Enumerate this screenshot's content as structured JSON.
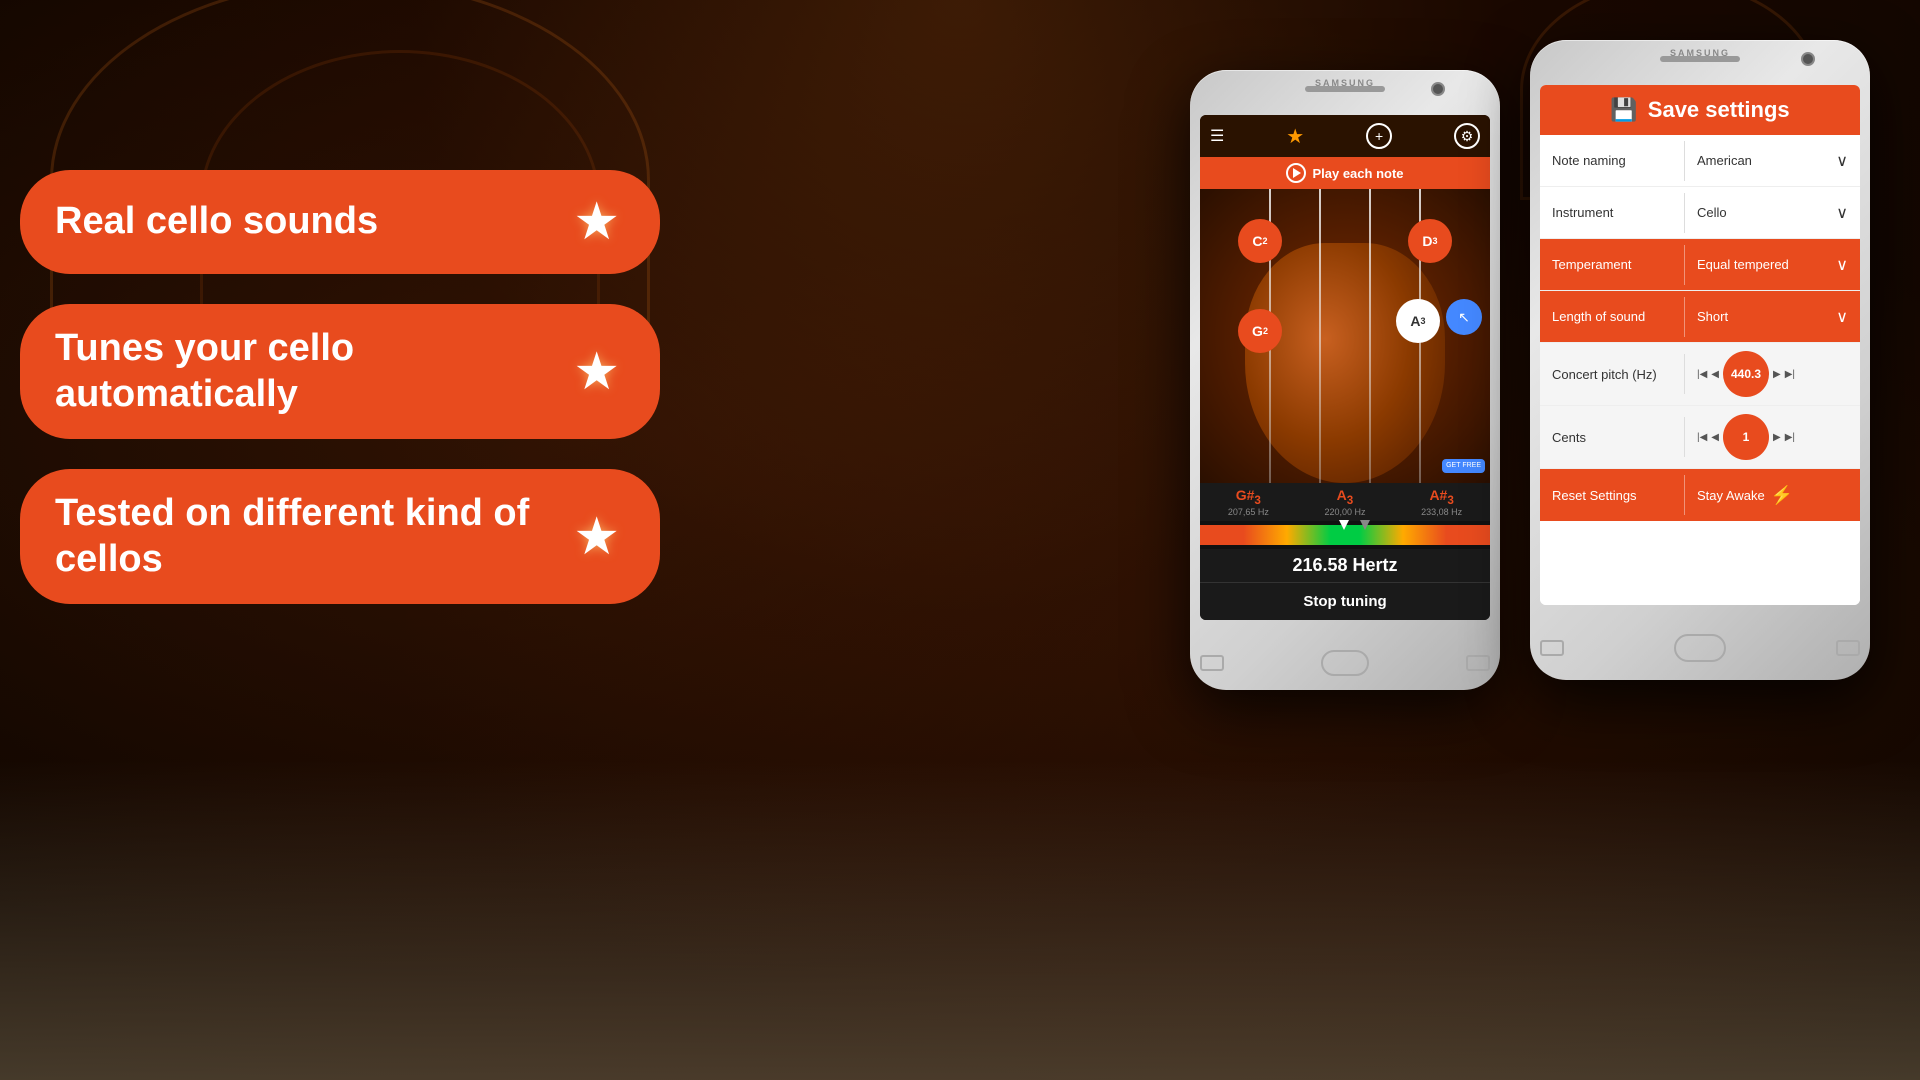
{
  "background": {
    "color": "#1a0800"
  },
  "features": {
    "items": [
      {
        "text": "Real cello sounds",
        "star": "★"
      },
      {
        "text": "Tunes your cello automatically",
        "star": "★"
      },
      {
        "text": "Tested on different kind of cellos",
        "star": "★"
      }
    ]
  },
  "phone1": {
    "brand": "SAMSUNG",
    "header": {
      "menu_icon": "☰",
      "star_icon": "★",
      "plus_icon": "+",
      "gear_icon": "⚙"
    },
    "play_button": "Play each note",
    "notes": [
      {
        "id": "c2",
        "name": "C",
        "sub": "2"
      },
      {
        "id": "d3",
        "name": "D",
        "sub": "3"
      },
      {
        "id": "g2",
        "name": "G",
        "sub": "2"
      },
      {
        "id": "a3",
        "name": "A",
        "sub": "3"
      }
    ],
    "frequencies": [
      {
        "note": "G#₃",
        "hz": "207,65 Hz"
      },
      {
        "note": "A₃",
        "hz": "220,00 Hz"
      },
      {
        "note": "A#₃",
        "hz": "233,08 Hz"
      }
    ],
    "hertz_display": "216.58 Hertz",
    "stop_button": "Stop tuning",
    "get_free": "GET FREE"
  },
  "phone2": {
    "brand": "SAMSUNG",
    "header": {
      "icon": "💾",
      "title": "Save settings"
    },
    "settings": [
      {
        "label": "Note naming",
        "value": "American",
        "has_chevron": true,
        "orange": false
      },
      {
        "label": "Instrument",
        "value": "Cello",
        "has_chevron": true,
        "orange": false
      },
      {
        "label": "Temperament",
        "value": "Equal tempered",
        "has_chevron": true,
        "orange": false
      },
      {
        "label": "Length of sound",
        "value": "Short",
        "has_chevron": true,
        "orange": false
      }
    ],
    "concert_pitch": {
      "label": "Concert pitch (Hz)",
      "value": "440.3"
    },
    "cents": {
      "label": "Cents",
      "value": "1"
    },
    "reset": {
      "label": "Reset Settings",
      "stay_awake": "Stay Awake",
      "stay_awake_icon": "⚡"
    }
  }
}
